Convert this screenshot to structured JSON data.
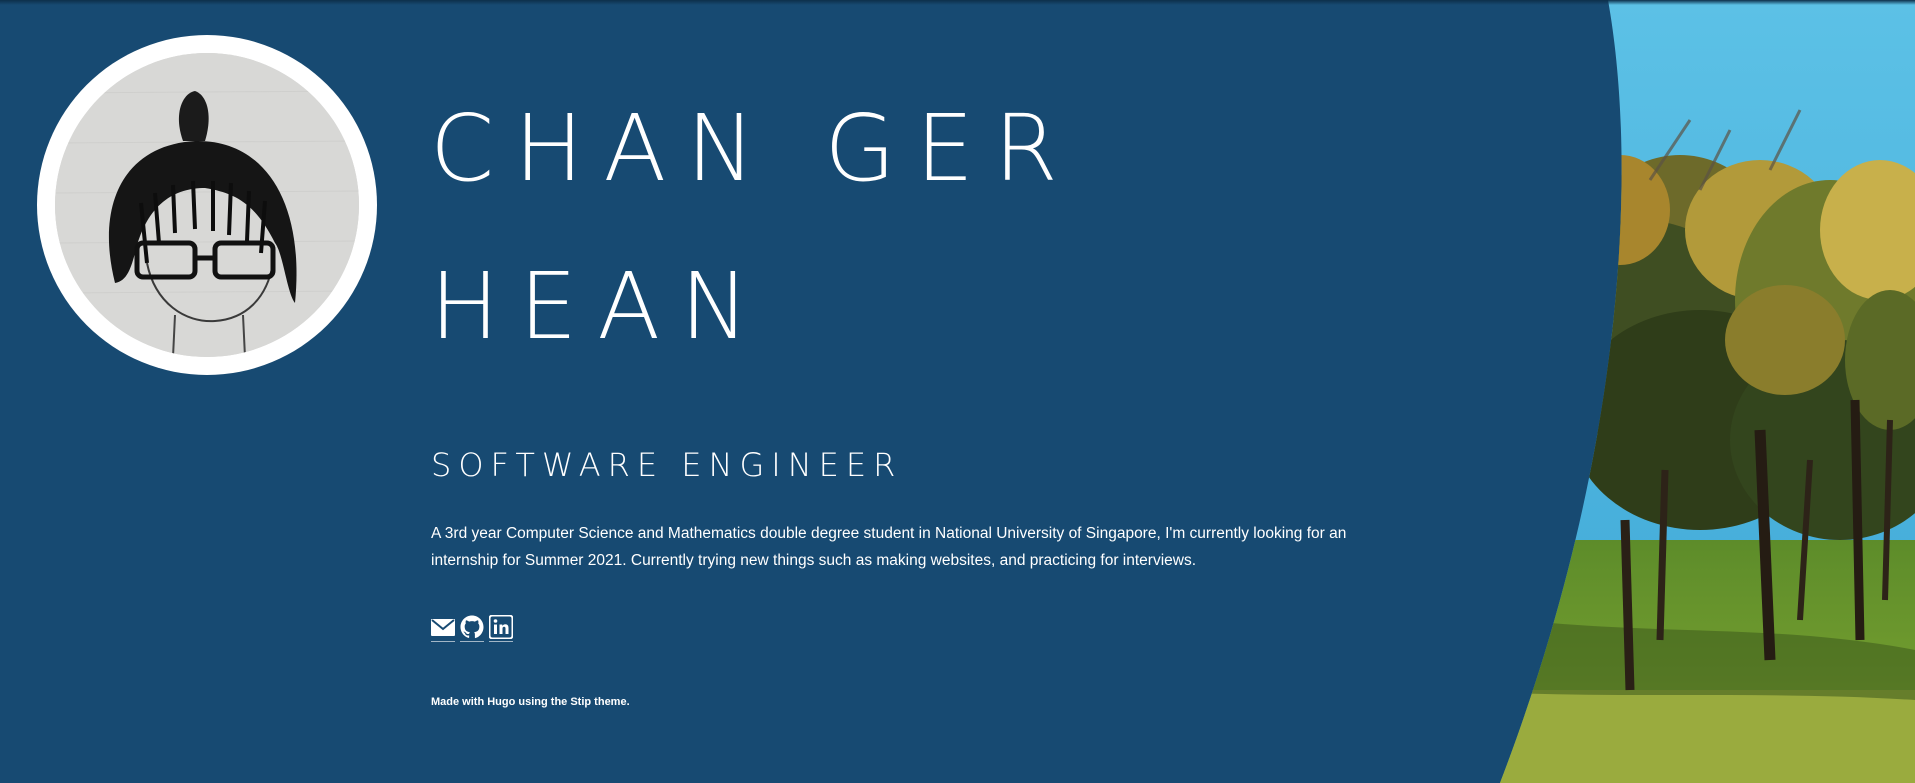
{
  "profile": {
    "name": "CHAN GER HEAN",
    "role": "SOFTWARE ENGINEER",
    "bio": "A 3rd year Computer Science and Mathematics double degree student in National University of Singapore, I'm currently looking for an internship for Summer 2021. Currently trying new things such as making websites, and practicing for interviews.",
    "avatar_icon": "hand-drawn-portrait"
  },
  "socials": [
    {
      "icon": "envelope-icon"
    },
    {
      "icon": "github-icon"
    },
    {
      "icon": "linkedin-icon"
    }
  ],
  "footer": {
    "prefix": "Made with ",
    "hugo_link": "Hugo",
    "middle": " using the ",
    "theme_link": "Stip",
    "suffix": " theme."
  },
  "colors": {
    "background": "#174a72",
    "text": "#ffffff",
    "sky": "#46b3de",
    "grass": "#7fa131"
  }
}
